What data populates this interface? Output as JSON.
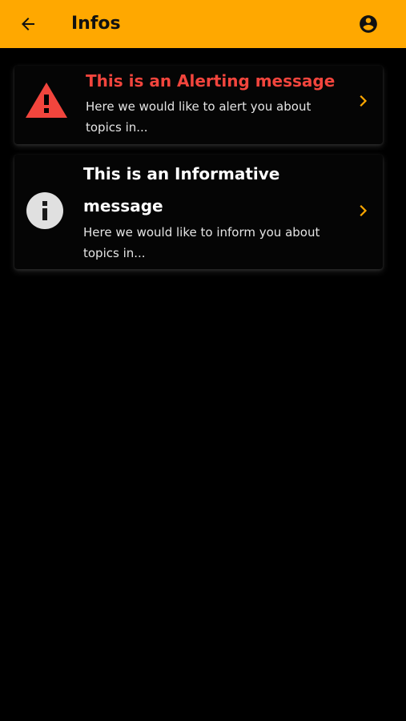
{
  "header": {
    "title": "Infos",
    "back_icon": "arrow-left-icon",
    "account_icon": "account-circle-icon",
    "background_color": "#FFA800"
  },
  "messages": [
    {
      "type": "alert",
      "icon": "warning-triangle-icon",
      "title": "This is an Alerting message",
      "body": "Here we would like to alert you about topics in...",
      "title_color": "#F2453D"
    },
    {
      "type": "info",
      "icon": "info-circle-icon",
      "title": "This is an Informative message",
      "body": "Here we would like to inform you about topics in...",
      "title_color": "#FFFFFF"
    }
  ],
  "colors": {
    "accent": "#FFA800",
    "alert": "#F2453D",
    "background": "#000000"
  }
}
